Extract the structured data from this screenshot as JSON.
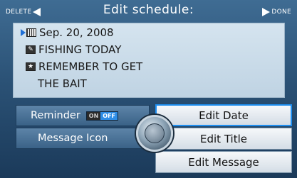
{
  "header": {
    "title": "Edit schedule:",
    "delete_label": "DELETE",
    "done_label": "DONE"
  },
  "schedule": {
    "date": "Sep. 20, 2008",
    "title": "FISHING TODAY",
    "message_line1": "REMEMBER TO GET",
    "message_line2": "THE BAIT"
  },
  "controls": {
    "reminder_label": "Reminder",
    "reminder_on": "ON",
    "reminder_off": "OFF",
    "reminder_state": "OFF",
    "message_icon_label": "Message Icon",
    "edit_date": "Edit Date",
    "edit_title": "Edit Title",
    "edit_message": "Edit Message",
    "selected": "Edit Date"
  },
  "icons": {
    "date": "calendar-icon",
    "title": "pencil-icon",
    "message": "star-icon"
  },
  "colors": {
    "background": "#2b5276",
    "highlight": "#1e8ef0",
    "toggle_active": "#2e8de6"
  }
}
